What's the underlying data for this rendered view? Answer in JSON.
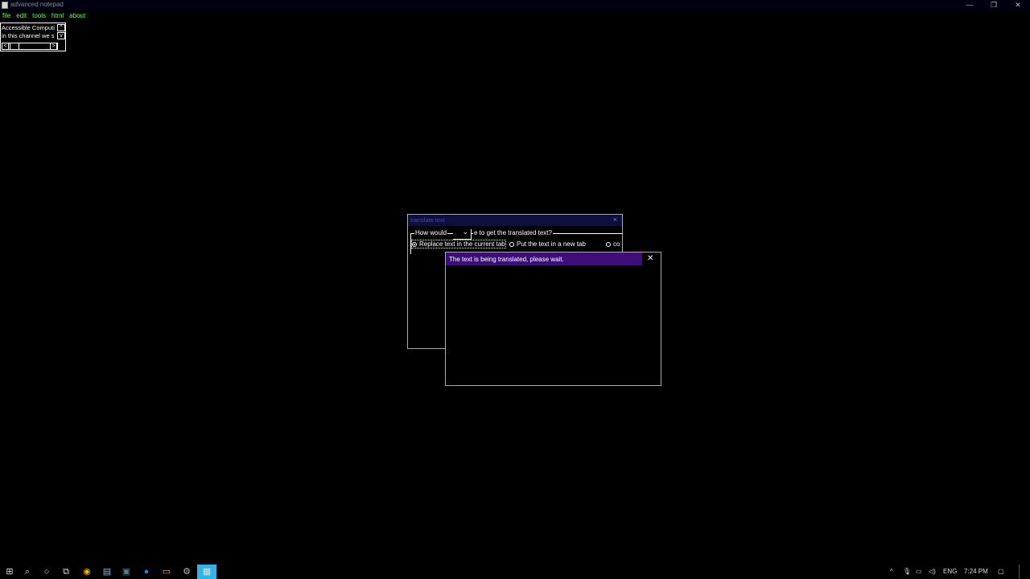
{
  "window": {
    "title": "advanced notepad",
    "minimize": "—",
    "restore": "❐",
    "close": "✕"
  },
  "menu": [
    "file",
    "edit",
    "tools",
    "html",
    "about"
  ],
  "combo": {
    "line1": "Accessible Computi",
    "line2": "in this channel we s",
    "up_arrow": "^",
    "down_arrow": "v",
    "left_arrow": "<",
    "right_arrow": ">"
  },
  "translate_dialog": {
    "title": "translate text",
    "close": "×",
    "group_label_start": "How would",
    "group_label_end": "e to get the translated text?",
    "options": [
      {
        "label": "Replace text in the current tab",
        "checked": true
      },
      {
        "label": "Put the text in a new tab",
        "checked": false
      },
      {
        "label": "co",
        "checked": false
      }
    ]
  },
  "wait_dialog": {
    "message": "The text is being translated, please wait.",
    "close": "✕"
  },
  "taskbar": {
    "items": [
      "start-icon",
      "search-icon",
      "cortana-icon",
      "task-view-icon",
      "chrome-icon",
      "notepad-icon",
      "app-icon",
      "edge-icon",
      "explorer-icon",
      "settings-icon",
      "advanced-notepad-icon"
    ],
    "tray": {
      "chevron": "^",
      "language": "ENG",
      "time": "7:24 PM"
    }
  }
}
